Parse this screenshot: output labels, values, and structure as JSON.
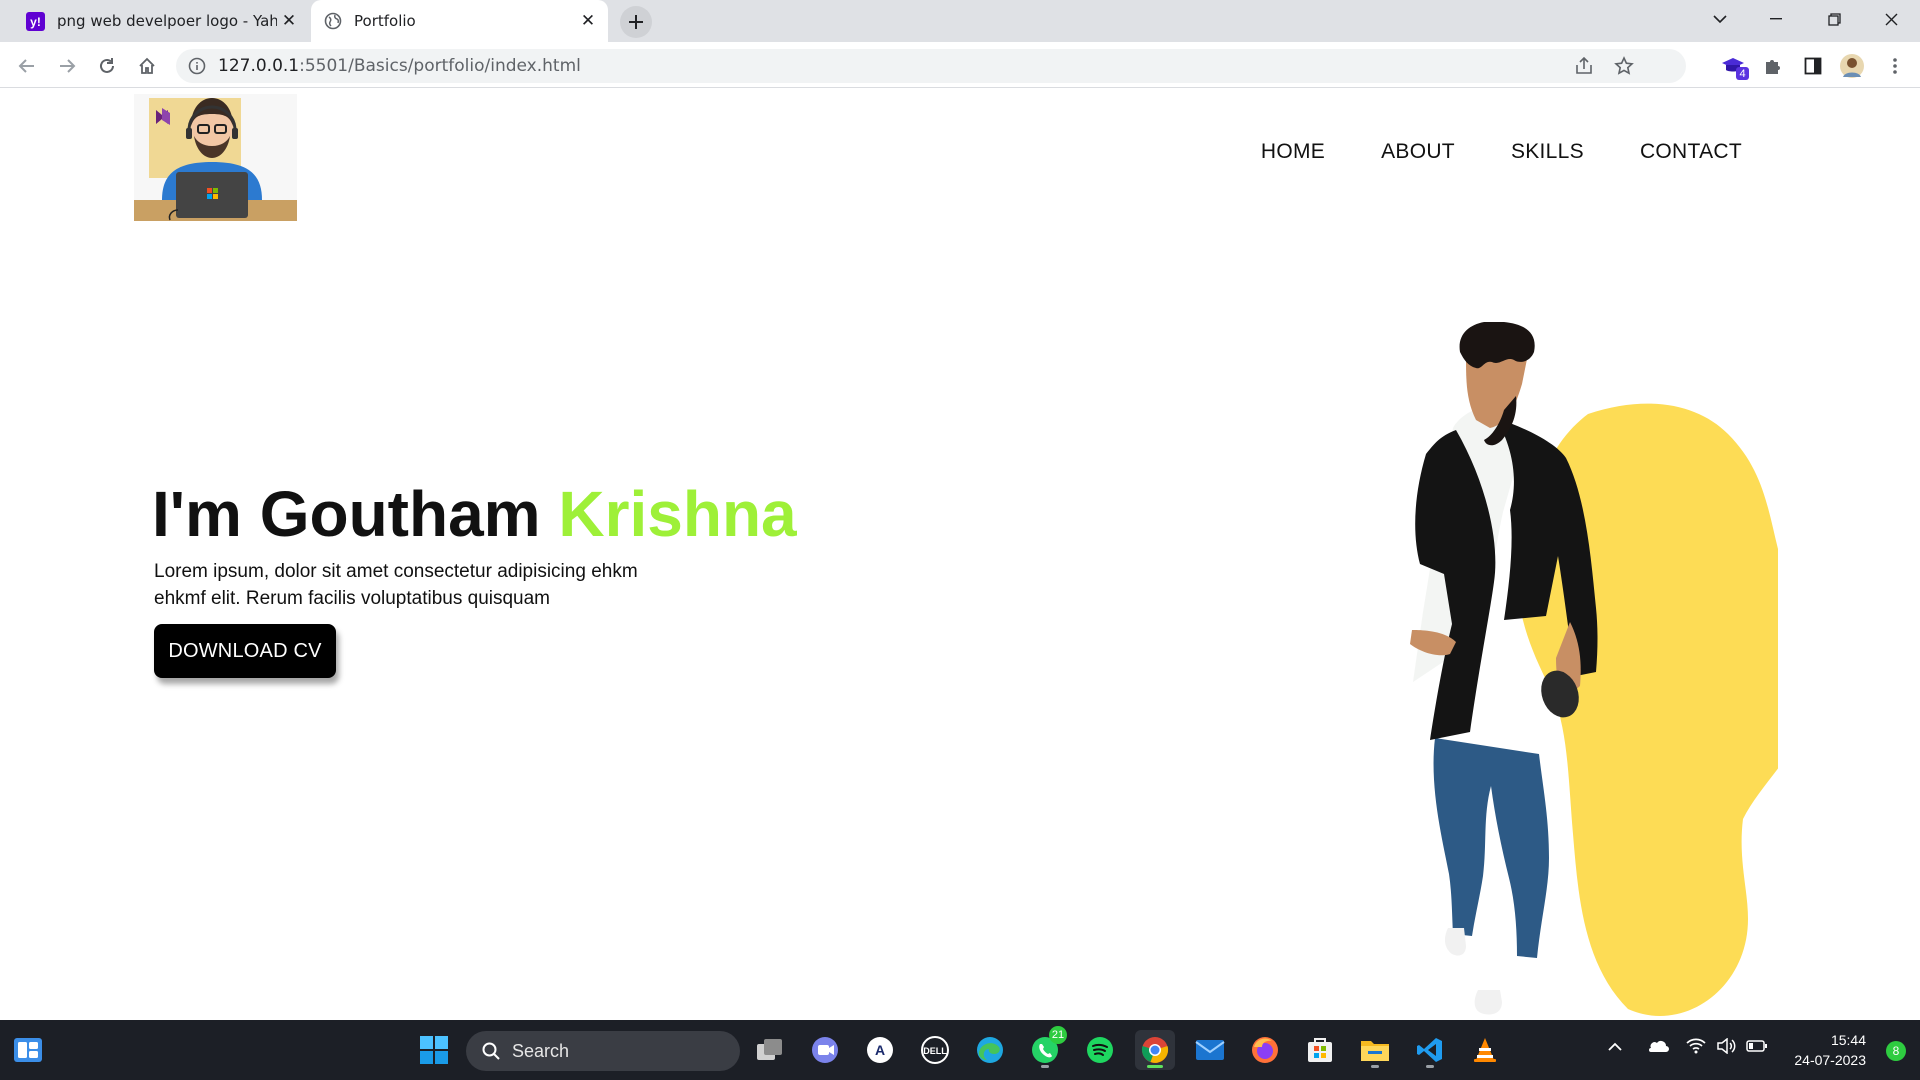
{
  "browser": {
    "tabs": [
      {
        "title": "png web develpoer logo - Yahoo",
        "favicon": "yahoo-icon",
        "active": false
      },
      {
        "title": "Portfolio",
        "favicon": "globe-icon",
        "active": true
      }
    ],
    "url_host": "127.0.0.1",
    "url_rest": ":5501/Basics/portfolio/index.html",
    "extension_badge": "4"
  },
  "page": {
    "nav": [
      {
        "label": "HOME"
      },
      {
        "label": "ABOUT"
      },
      {
        "label": "SKILLS"
      },
      {
        "label": "CONTACT"
      }
    ],
    "hero": {
      "title_prefix": "I'm Goutham ",
      "title_accent": "Krishna",
      "text": "Lorem ipsum, dolor sit amet consectetur adipisicing ehkm ehkmf elit. Rerum facilis voluptatibus quisquam",
      "button": "DOWNLOAD CV"
    },
    "colors": {
      "accent": "#9ef038",
      "blob": "#fddc55",
      "button": "#000000"
    }
  },
  "taskbar": {
    "search_label": "Search",
    "whatsapp_badge": "21",
    "time": "15:44",
    "date": "24-07-2023",
    "notification_count": "8"
  }
}
